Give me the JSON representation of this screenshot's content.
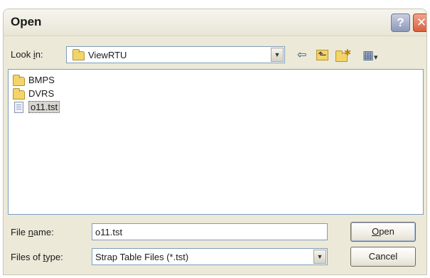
{
  "window": {
    "title": "Open",
    "help_label": "?",
    "close_label": "✕"
  },
  "look_in": {
    "label_prefix": "Look ",
    "label_hotkey": "i",
    "label_suffix": "n:",
    "value": "ViewRTU"
  },
  "toolbar": {
    "back_icon": "⇦",
    "up_icon": "⬑",
    "new_folder_icon": "✱",
    "views_icon": "▦",
    "views_arrow": "▾"
  },
  "files": [
    {
      "name": "BMPS",
      "type": "folder"
    },
    {
      "name": "DVRS",
      "type": "folder"
    },
    {
      "name": "o11.tst",
      "type": "file",
      "selected": true
    }
  ],
  "file_name": {
    "label_prefix": "File ",
    "label_hotkey": "n",
    "label_suffix": "ame:",
    "value": "o11.tst"
  },
  "files_of_type": {
    "label_prefix": "Files of ",
    "label_hotkey": "t",
    "label_suffix": "ype:",
    "value": "Strap Table Files (*.tst)"
  },
  "buttons": {
    "open_hotkey": "O",
    "open_rest": "pen",
    "cancel": "Cancel"
  },
  "colors": {
    "dialog_bg": "#ece9d8",
    "field_border": "#7f9db9",
    "folder": "#f3d46a",
    "close_button": "#d9603c"
  }
}
